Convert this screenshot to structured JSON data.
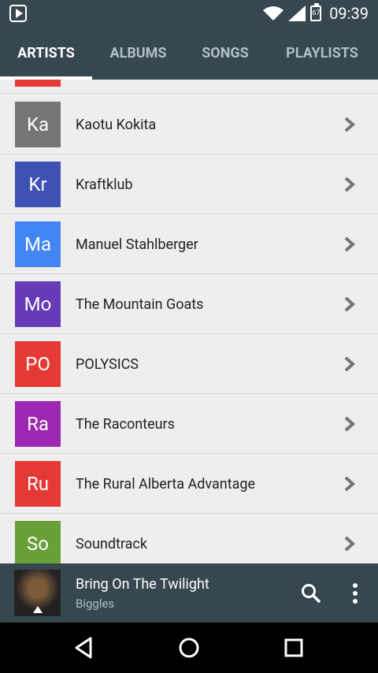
{
  "status": {
    "time": "09:39",
    "battery_level": "67"
  },
  "tabs": [
    {
      "label": "ARTISTS"
    },
    {
      "label": "ALBUMS"
    },
    {
      "label": "SONGS"
    },
    {
      "label": "PLAYLISTS"
    }
  ],
  "artists": [
    {
      "initials": "Ka",
      "name": "Kaotu Kokita",
      "color": "#757575"
    },
    {
      "initials": "Kr",
      "name": "Kraftklub",
      "color": "#3f51b5"
    },
    {
      "initials": "Ma",
      "name": "Manuel Stahlberger",
      "color": "#4285f4"
    },
    {
      "initials": "Mo",
      "name": "The Mountain Goats",
      "color": "#673ab7"
    },
    {
      "initials": "PO",
      "name": "POLYSICS",
      "color": "#e53935"
    },
    {
      "initials": "Ra",
      "name": "The Raconteurs",
      "color": "#9c27b0"
    },
    {
      "initials": "Ru",
      "name": "The Rural Alberta Advantage",
      "color": "#e53935"
    },
    {
      "initials": "So",
      "name": "Soundtrack",
      "color": "#689f38"
    }
  ],
  "now_playing": {
    "title": "Bring On The Twilight",
    "artist": "Biggles"
  },
  "colors": {
    "primary": "#37474f",
    "accent_partial_row": "#e53935"
  }
}
